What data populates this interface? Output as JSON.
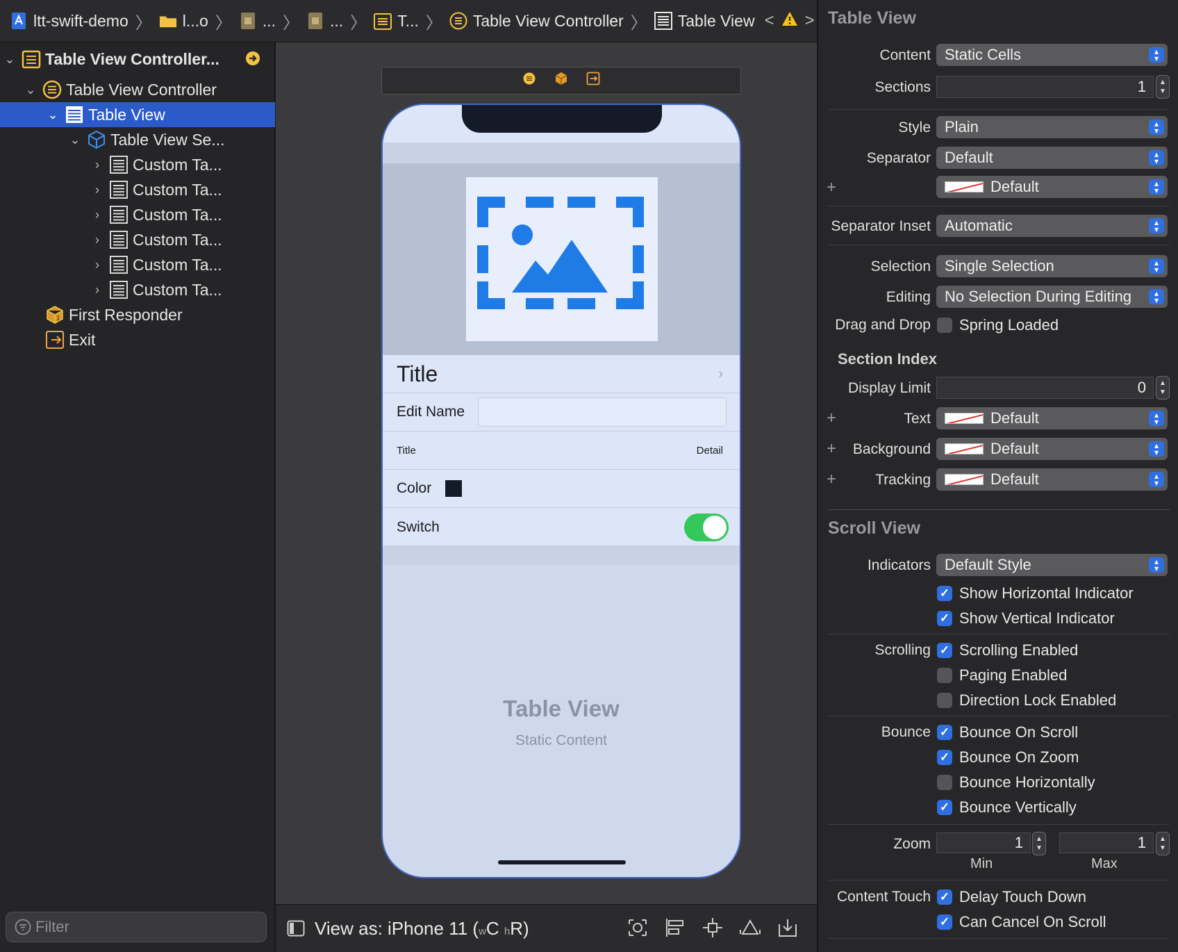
{
  "breadcrumb": {
    "items": [
      "ltt-swift-demo",
      "l...o",
      "...",
      "...",
      "T...",
      "Table View Controller",
      "Table View"
    ]
  },
  "navigator": {
    "items": [
      {
        "label": "Table View Controller...",
        "disclosure": "open"
      },
      {
        "label": "Table View Controller",
        "disclosure": "open"
      },
      {
        "label": "Table View",
        "disclosure": "open"
      },
      {
        "label": "Table View Se...",
        "disclosure": "open"
      },
      {
        "label": "Custom Ta...",
        "disclosure": "closed"
      },
      {
        "label": "Custom Ta...",
        "disclosure": "closed"
      },
      {
        "label": "Custom Ta...",
        "disclosure": "closed"
      },
      {
        "label": "Custom Ta...",
        "disclosure": "closed"
      },
      {
        "label": "Custom Ta...",
        "disclosure": "closed"
      },
      {
        "label": "Custom Ta...",
        "disclosure": "closed"
      },
      {
        "label": "First Responder",
        "disclosure": "none"
      },
      {
        "label": "Exit",
        "disclosure": "none"
      }
    ],
    "filter_placeholder": "Filter"
  },
  "canvas": {
    "cells": {
      "title": "Title",
      "edit_name": "Edit Name",
      "subtitle_title": "Title",
      "subtitle_detail": "Detail",
      "color": "Color",
      "switch": "Switch"
    },
    "switch_on": true,
    "empty_title": "Table View",
    "empty_subtitle": "Static Content",
    "view_as": "View as: iPhone 11 (",
    "view_as_w": "w",
    "view_as_c": "C ",
    "view_as_h": "h",
    "view_as_r": "R)"
  },
  "inspector": {
    "table_view": {
      "title": "Table View",
      "content_label": "Content",
      "content_value": "Static Cells",
      "sections_label": "Sections",
      "sections_value": "1",
      "style_label": "Style",
      "style_value": "Plain",
      "separator_label": "Separator",
      "separator_value": "Default",
      "separator_color_value": "Default",
      "separator_inset_label": "Separator Inset",
      "separator_inset_value": "Automatic",
      "selection_label": "Selection",
      "selection_value": "Single Selection",
      "editing_label": "Editing",
      "editing_value": "No Selection During Editing",
      "drag_drop_label": "Drag and Drop",
      "spring_loaded": "Spring Loaded",
      "section_index_title": "Section Index",
      "display_limit_label": "Display Limit",
      "display_limit_value": "0",
      "text_label": "Text",
      "text_value": "Default",
      "background_label": "Background",
      "background_value": "Default",
      "tracking_label": "Tracking",
      "tracking_value": "Default"
    },
    "scroll_view": {
      "title": "Scroll View",
      "indicators_label": "Indicators",
      "indicators_value": "Default Style",
      "show_horizontal": "Show Horizontal Indicator",
      "show_vertical": "Show Vertical Indicator",
      "scrolling_label": "Scrolling",
      "scrolling_enabled": "Scrolling Enabled",
      "paging_enabled": "Paging Enabled",
      "direction_lock": "Direction Lock Enabled",
      "bounce_label": "Bounce",
      "bounce_on_scroll": "Bounce On Scroll",
      "bounce_on_zoom": "Bounce On Zoom",
      "bounce_horizontally": "Bounce Horizontally",
      "bounce_vertically": "Bounce Vertically",
      "zoom_label": "Zoom",
      "zoom_min": "1",
      "zoom_max": "1",
      "min_caption": "Min",
      "max_caption": "Max",
      "content_touch_label": "Content Touch",
      "delay_touch_down": "Delay Touch Down",
      "can_cancel_on_scroll": "Can Cancel On Scroll"
    },
    "checked": {
      "show_horizontal": true,
      "show_vertical": true,
      "scrolling_enabled": true,
      "paging_enabled": false,
      "direction_lock": false,
      "bounce_on_scroll": true,
      "bounce_on_zoom": true,
      "bounce_horizontally": false,
      "bounce_vertically": true,
      "delay_touch_down": true,
      "can_cancel_on_scroll": true,
      "spring_loaded": false
    }
  },
  "colors": {
    "accent": "#2f6fe0",
    "selection": "#2a5bc9",
    "switch_on": "#34c759",
    "placeholder_blue": "#1f7be6",
    "warning": "#f5c518"
  }
}
